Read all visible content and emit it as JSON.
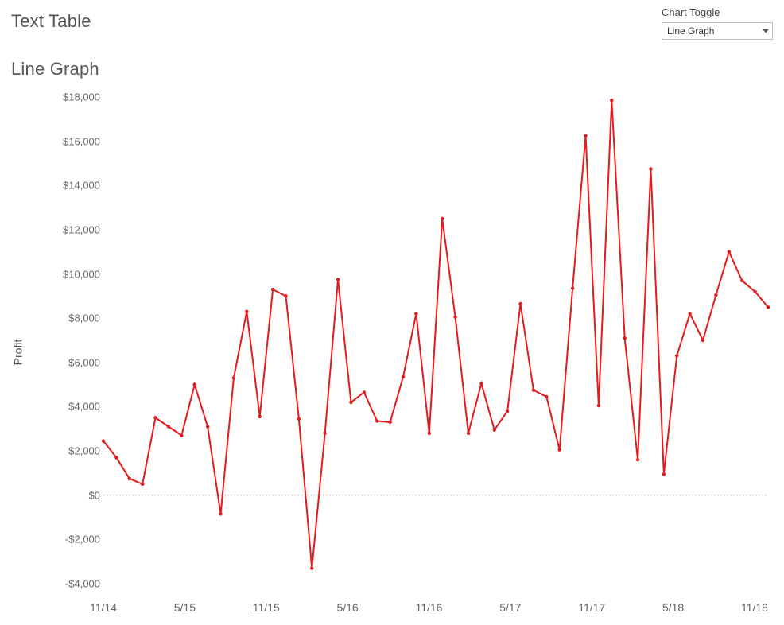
{
  "headings": {
    "text_table": "Text Table",
    "line_graph": "Line Graph"
  },
  "toggle": {
    "label": "Chart Toggle",
    "selected": "Line Graph"
  },
  "chart_data": {
    "type": "line",
    "title": "",
    "xlabel": "",
    "ylabel": "Profit",
    "ylim": [
      -4000,
      18000
    ],
    "y_ticks": [
      -4000,
      -2000,
      0,
      2000,
      4000,
      6000,
      8000,
      10000,
      12000,
      14000,
      16000,
      18000
    ],
    "y_tick_labels": [
      "-$4,000",
      "-$2,000",
      "$0",
      "$2,000",
      "$4,000",
      "$6,000",
      "$8,000",
      "$10,000",
      "$12,000",
      "$14,000",
      "$16,000",
      "$18,000"
    ],
    "x_tick_positions": [
      0,
      6,
      12,
      18,
      24,
      30,
      36,
      42,
      48
    ],
    "x_tick_labels": [
      "11/14",
      "5/15",
      "11/15",
      "5/16",
      "11/16",
      "5/17",
      "11/17",
      "5/18",
      "11/18"
    ],
    "x_count": 50,
    "series": [
      {
        "name": "Profit",
        "color": "#e41a1c",
        "values": [
          2450,
          1700,
          750,
          500,
          3500,
          3100,
          2700,
          5000,
          3100,
          -850,
          5300,
          8300,
          3550,
          9300,
          9000,
          3450,
          -3300,
          2800,
          9750,
          4200,
          4650,
          3350,
          3300,
          5350,
          8200,
          2800,
          12500,
          8050,
          2800,
          5050,
          2950,
          3800,
          8650,
          4750,
          4450,
          2050,
          9350,
          16250,
          4050,
          17850,
          7100,
          1600,
          14750,
          950,
          6300,
          8200,
          7000,
          9050,
          11000,
          9700,
          9200,
          8500
        ]
      }
    ]
  }
}
